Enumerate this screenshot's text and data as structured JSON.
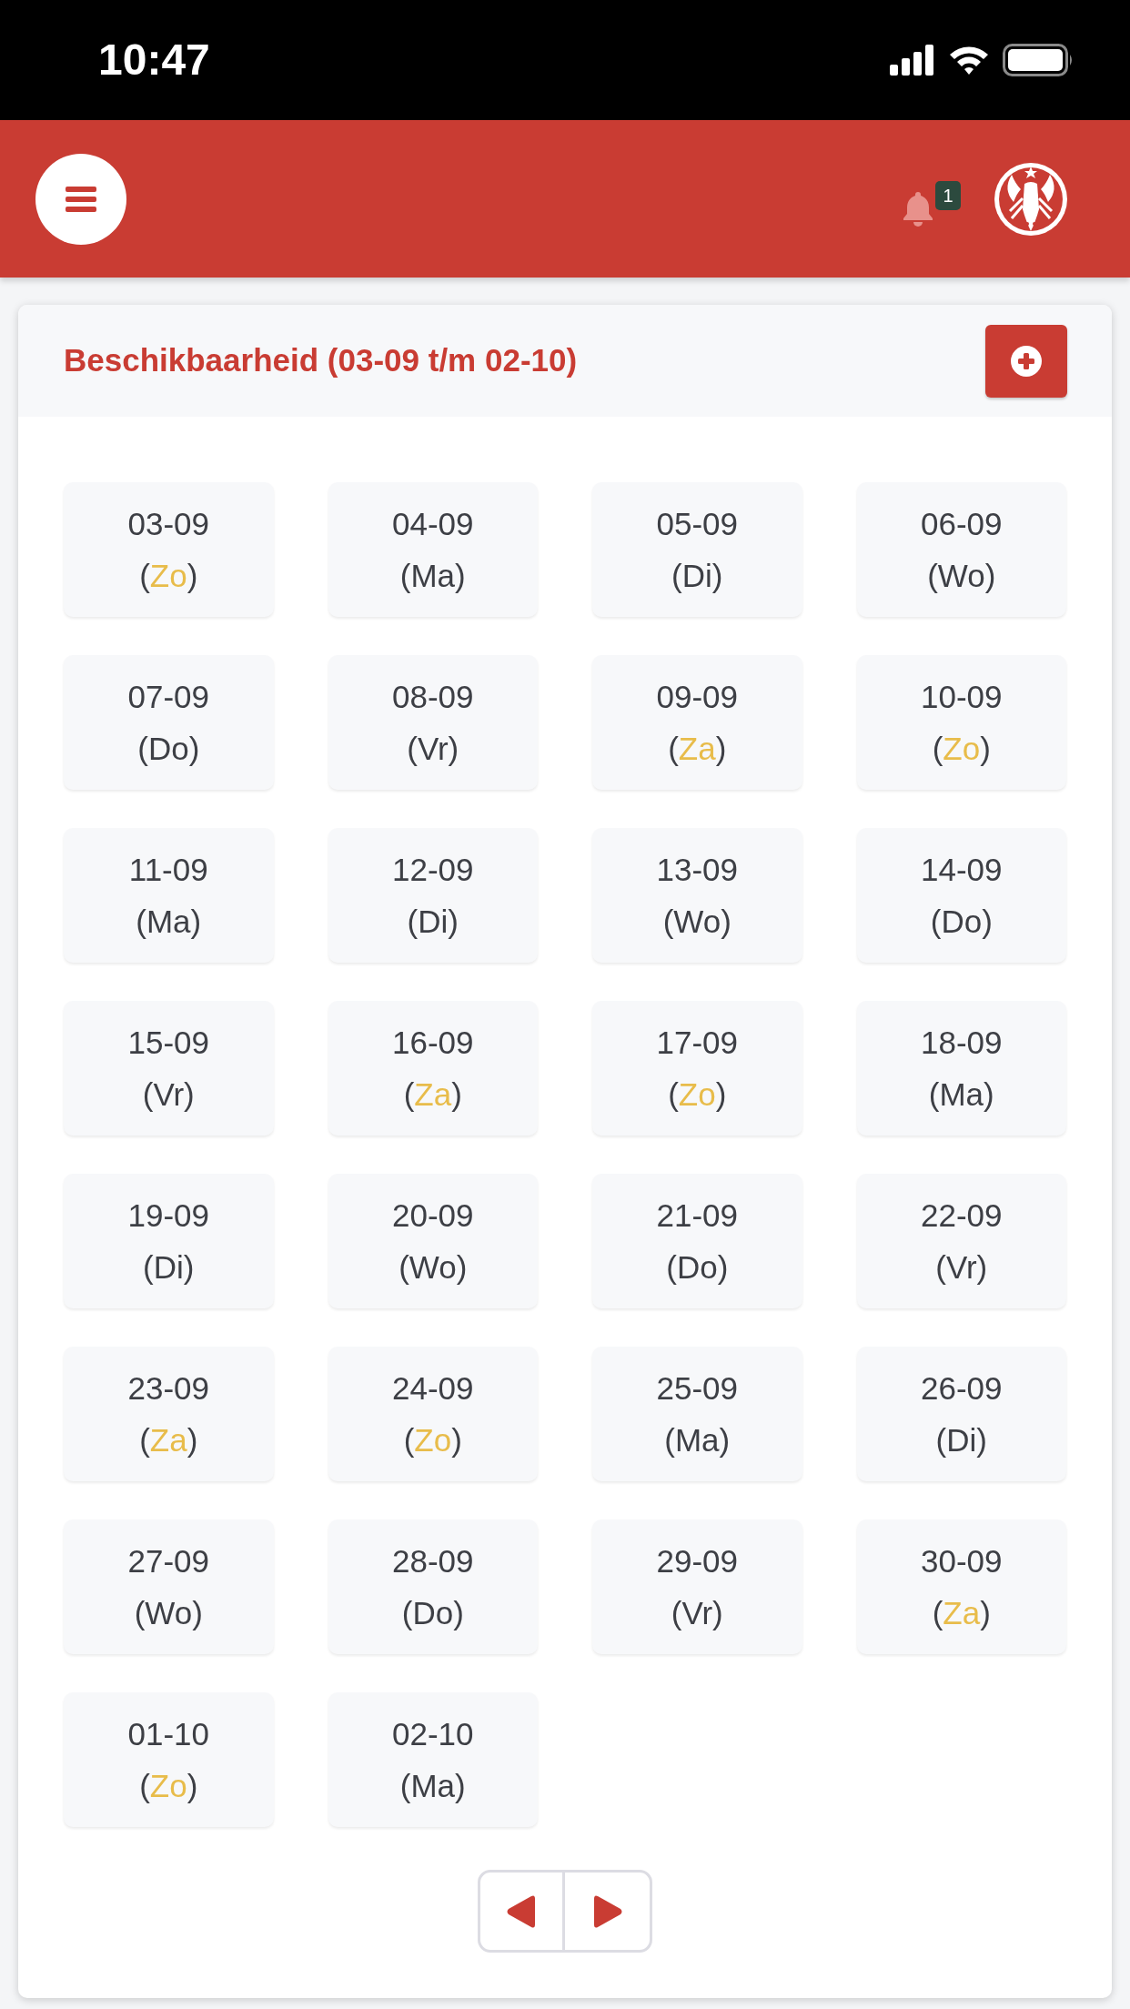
{
  "status_bar": {
    "time": "10:47"
  },
  "header": {
    "notification_count": "1"
  },
  "card": {
    "title": "Beschikbaarheid (03-09 t/m 02-10)",
    "days": [
      {
        "date": "03-09",
        "day_prefix": "(",
        "day": "Zo",
        "day_suffix": ")",
        "weekend": true
      },
      {
        "date": "04-09",
        "day_prefix": "(",
        "day": "Ma",
        "day_suffix": ")",
        "weekend": false
      },
      {
        "date": "05-09",
        "day_prefix": "(",
        "day": "Di",
        "day_suffix": ")",
        "weekend": false
      },
      {
        "date": "06-09",
        "day_prefix": "(",
        "day": "Wo",
        "day_suffix": ")",
        "weekend": false
      },
      {
        "date": "07-09",
        "day_prefix": "(",
        "day": "Do",
        "day_suffix": ")",
        "weekend": false
      },
      {
        "date": "08-09",
        "day_prefix": "(",
        "day": "Vr",
        "day_suffix": ")",
        "weekend": false
      },
      {
        "date": "09-09",
        "day_prefix": "(",
        "day": "Za",
        "day_suffix": ")",
        "weekend": true
      },
      {
        "date": "10-09",
        "day_prefix": "(",
        "day": "Zo",
        "day_suffix": ")",
        "weekend": true
      },
      {
        "date": "11-09",
        "day_prefix": "(",
        "day": "Ma",
        "day_suffix": ")",
        "weekend": false
      },
      {
        "date": "12-09",
        "day_prefix": "(",
        "day": "Di",
        "day_suffix": ")",
        "weekend": false
      },
      {
        "date": "13-09",
        "day_prefix": "(",
        "day": "Wo",
        "day_suffix": ")",
        "weekend": false
      },
      {
        "date": "14-09",
        "day_prefix": "(",
        "day": "Do",
        "day_suffix": ")",
        "weekend": false
      },
      {
        "date": "15-09",
        "day_prefix": "(",
        "day": "Vr",
        "day_suffix": ")",
        "weekend": false
      },
      {
        "date": "16-09",
        "day_prefix": "(",
        "day": "Za",
        "day_suffix": ")",
        "weekend": true
      },
      {
        "date": "17-09",
        "day_prefix": "(",
        "day": "Zo",
        "day_suffix": ")",
        "weekend": true
      },
      {
        "date": "18-09",
        "day_prefix": "(",
        "day": "Ma",
        "day_suffix": ")",
        "weekend": false
      },
      {
        "date": "19-09",
        "day_prefix": "(",
        "day": "Di",
        "day_suffix": ")",
        "weekend": false
      },
      {
        "date": "20-09",
        "day_prefix": "(",
        "day": "Wo",
        "day_suffix": ")",
        "weekend": false
      },
      {
        "date": "21-09",
        "day_prefix": "(",
        "day": "Do",
        "day_suffix": ")",
        "weekend": false
      },
      {
        "date": "22-09",
        "day_prefix": "(",
        "day": "Vr",
        "day_suffix": ")",
        "weekend": false
      },
      {
        "date": "23-09",
        "day_prefix": "(",
        "day": "Za",
        "day_suffix": ")",
        "weekend": true
      },
      {
        "date": "24-09",
        "day_prefix": "(",
        "day": "Zo",
        "day_suffix": ")",
        "weekend": true
      },
      {
        "date": "25-09",
        "day_prefix": "(",
        "day": "Ma",
        "day_suffix": ")",
        "weekend": false
      },
      {
        "date": "26-09",
        "day_prefix": "(",
        "day": "Di",
        "day_suffix": ")",
        "weekend": false
      },
      {
        "date": "27-09",
        "day_prefix": "(",
        "day": "Wo",
        "day_suffix": ")",
        "weekend": false
      },
      {
        "date": "28-09",
        "day_prefix": "(",
        "day": "Do",
        "day_suffix": ")",
        "weekend": false
      },
      {
        "date": "29-09",
        "day_prefix": "(",
        "day": "Vr",
        "day_suffix": ")",
        "weekend": false
      },
      {
        "date": "30-09",
        "day_prefix": "(",
        "day": "Za",
        "day_suffix": ")",
        "weekend": true
      },
      {
        "date": "01-10",
        "day_prefix": "(",
        "day": "Zo",
        "day_suffix": ")",
        "weekend": true
      },
      {
        "date": "02-10",
        "day_prefix": "(",
        "day": "Ma",
        "day_suffix": ")",
        "weekend": false
      }
    ]
  }
}
